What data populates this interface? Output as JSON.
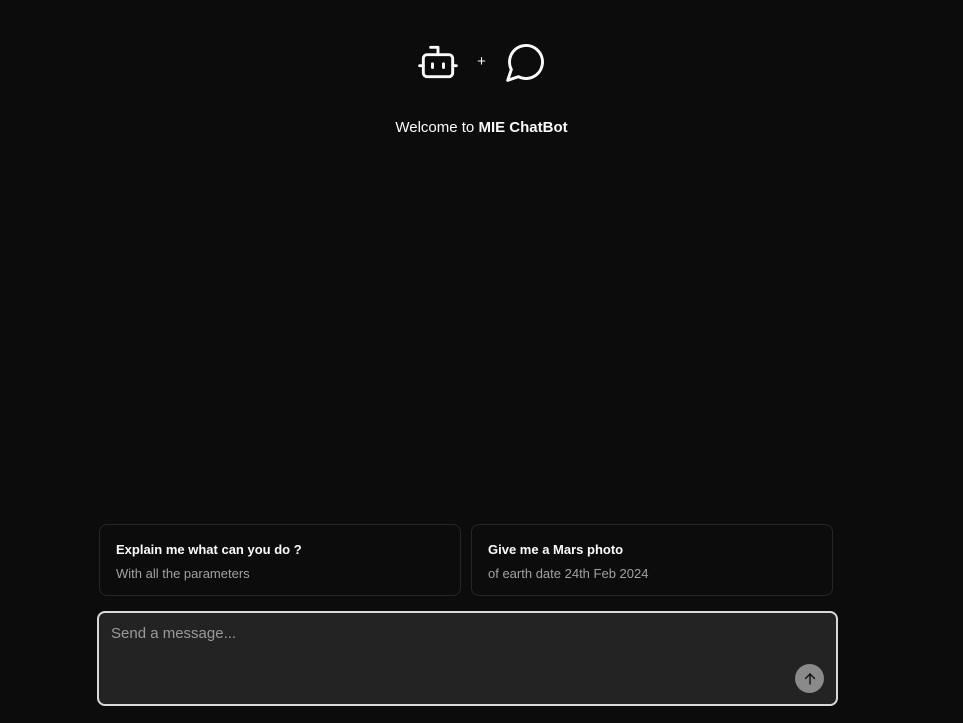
{
  "header": {
    "plus_symbol": "+",
    "welcome_prefix": "Welcome to ",
    "app_name": "MIE ChatBot",
    "icons": [
      "robot-icon",
      "chat-bubble-icon"
    ]
  },
  "suggestions": [
    {
      "title": "Explain me what can you do ?",
      "subtitle": "With all the parameters"
    },
    {
      "title": "Give me a Mars photo",
      "subtitle": "of earth date 24th Feb 2024"
    }
  ],
  "composer": {
    "placeholder": "Send a message...",
    "value": "",
    "send_icon": "arrow-up-icon"
  },
  "colors": {
    "background": "#0c0c0c",
    "text": "#fafafa",
    "muted_text": "#a1a1a1",
    "card_border": "#262626",
    "input_background": "#232323",
    "input_border": "#d9d9d9",
    "send_button": "#8a8a8a"
  }
}
